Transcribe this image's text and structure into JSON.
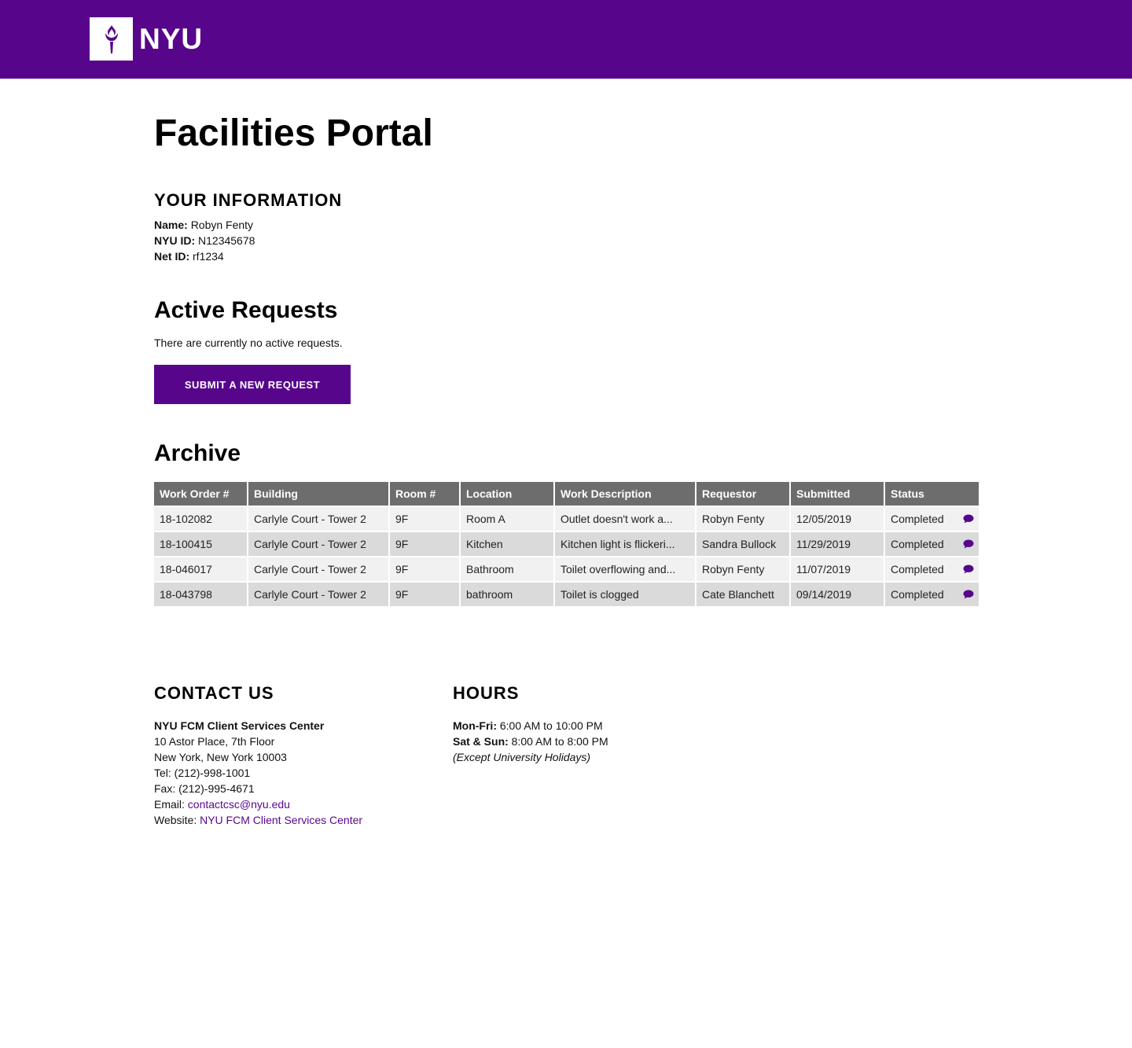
{
  "brand": {
    "name": "NYU",
    "logo_icon": "torch-icon",
    "color": "#57068c"
  },
  "page": {
    "title": "Facilities Portal"
  },
  "your_info": {
    "heading": "YOUR INFORMATION",
    "name_label": "Name:",
    "name_value": "Robyn Fenty",
    "nyuid_label": "NYU ID:",
    "nyuid_value": "N12345678",
    "netid_label": "Net ID:",
    "netid_value": "rf1234"
  },
  "active": {
    "heading": "Active Requests",
    "empty_text": "There are currently no active requests.",
    "submit_label": "SUBMIT A NEW REQUEST"
  },
  "archive": {
    "heading": "Archive",
    "columns": [
      "Work Order #",
      "Building",
      "Room #",
      "Location",
      "Work Description",
      "Requestor",
      "Submitted",
      "Status"
    ],
    "rows": [
      [
        "18-102082",
        "Carlyle Court - Tower 2",
        "9F",
        "Room A",
        "Outlet doesn't work a...",
        "Robyn Fenty",
        "12/05/2019",
        "Completed"
      ],
      [
        "18-100415",
        "Carlyle Court - Tower 2",
        "9F",
        "Kitchen",
        "Kitchen light is flickeri...",
        "Sandra Bullock",
        "11/29/2019",
        "Completed"
      ],
      [
        "18-046017",
        "Carlyle Court - Tower 2",
        "9F",
        "Bathroom",
        "Toilet overflowing and...",
        "Robyn Fenty",
        "11/07/2019",
        "Completed"
      ],
      [
        "18-043798",
        "Carlyle Court - Tower 2",
        "9F",
        "bathroom",
        "Toilet is clogged",
        "Cate Blanchett",
        "09/14/2019",
        "Completed"
      ]
    ],
    "row_icon": "chat-bubble-icon"
  },
  "contact": {
    "heading": "CONTACT US",
    "org": "NYU FCM Client Services Center",
    "address1": "10 Astor Place, 7th Floor",
    "address2": "New York, New York 10003",
    "tel": "Tel: (212)-998-1001",
    "fax": "Fax: (212)-995-4671",
    "email_label": "Email:",
    "email_value": "contactcsc@nyu.edu",
    "website_label": "Website:",
    "website_value": "NYU FCM Client Services Center"
  },
  "hours": {
    "heading": "HOURS",
    "weekday_label": "Mon-Fri:",
    "weekday_value": "6:00 AM to 10:00 PM",
    "weekend_label": "Sat & Sun:",
    "weekend_value": "8:00 AM to 8:00 PM",
    "note": "(Except University Holidays)"
  }
}
